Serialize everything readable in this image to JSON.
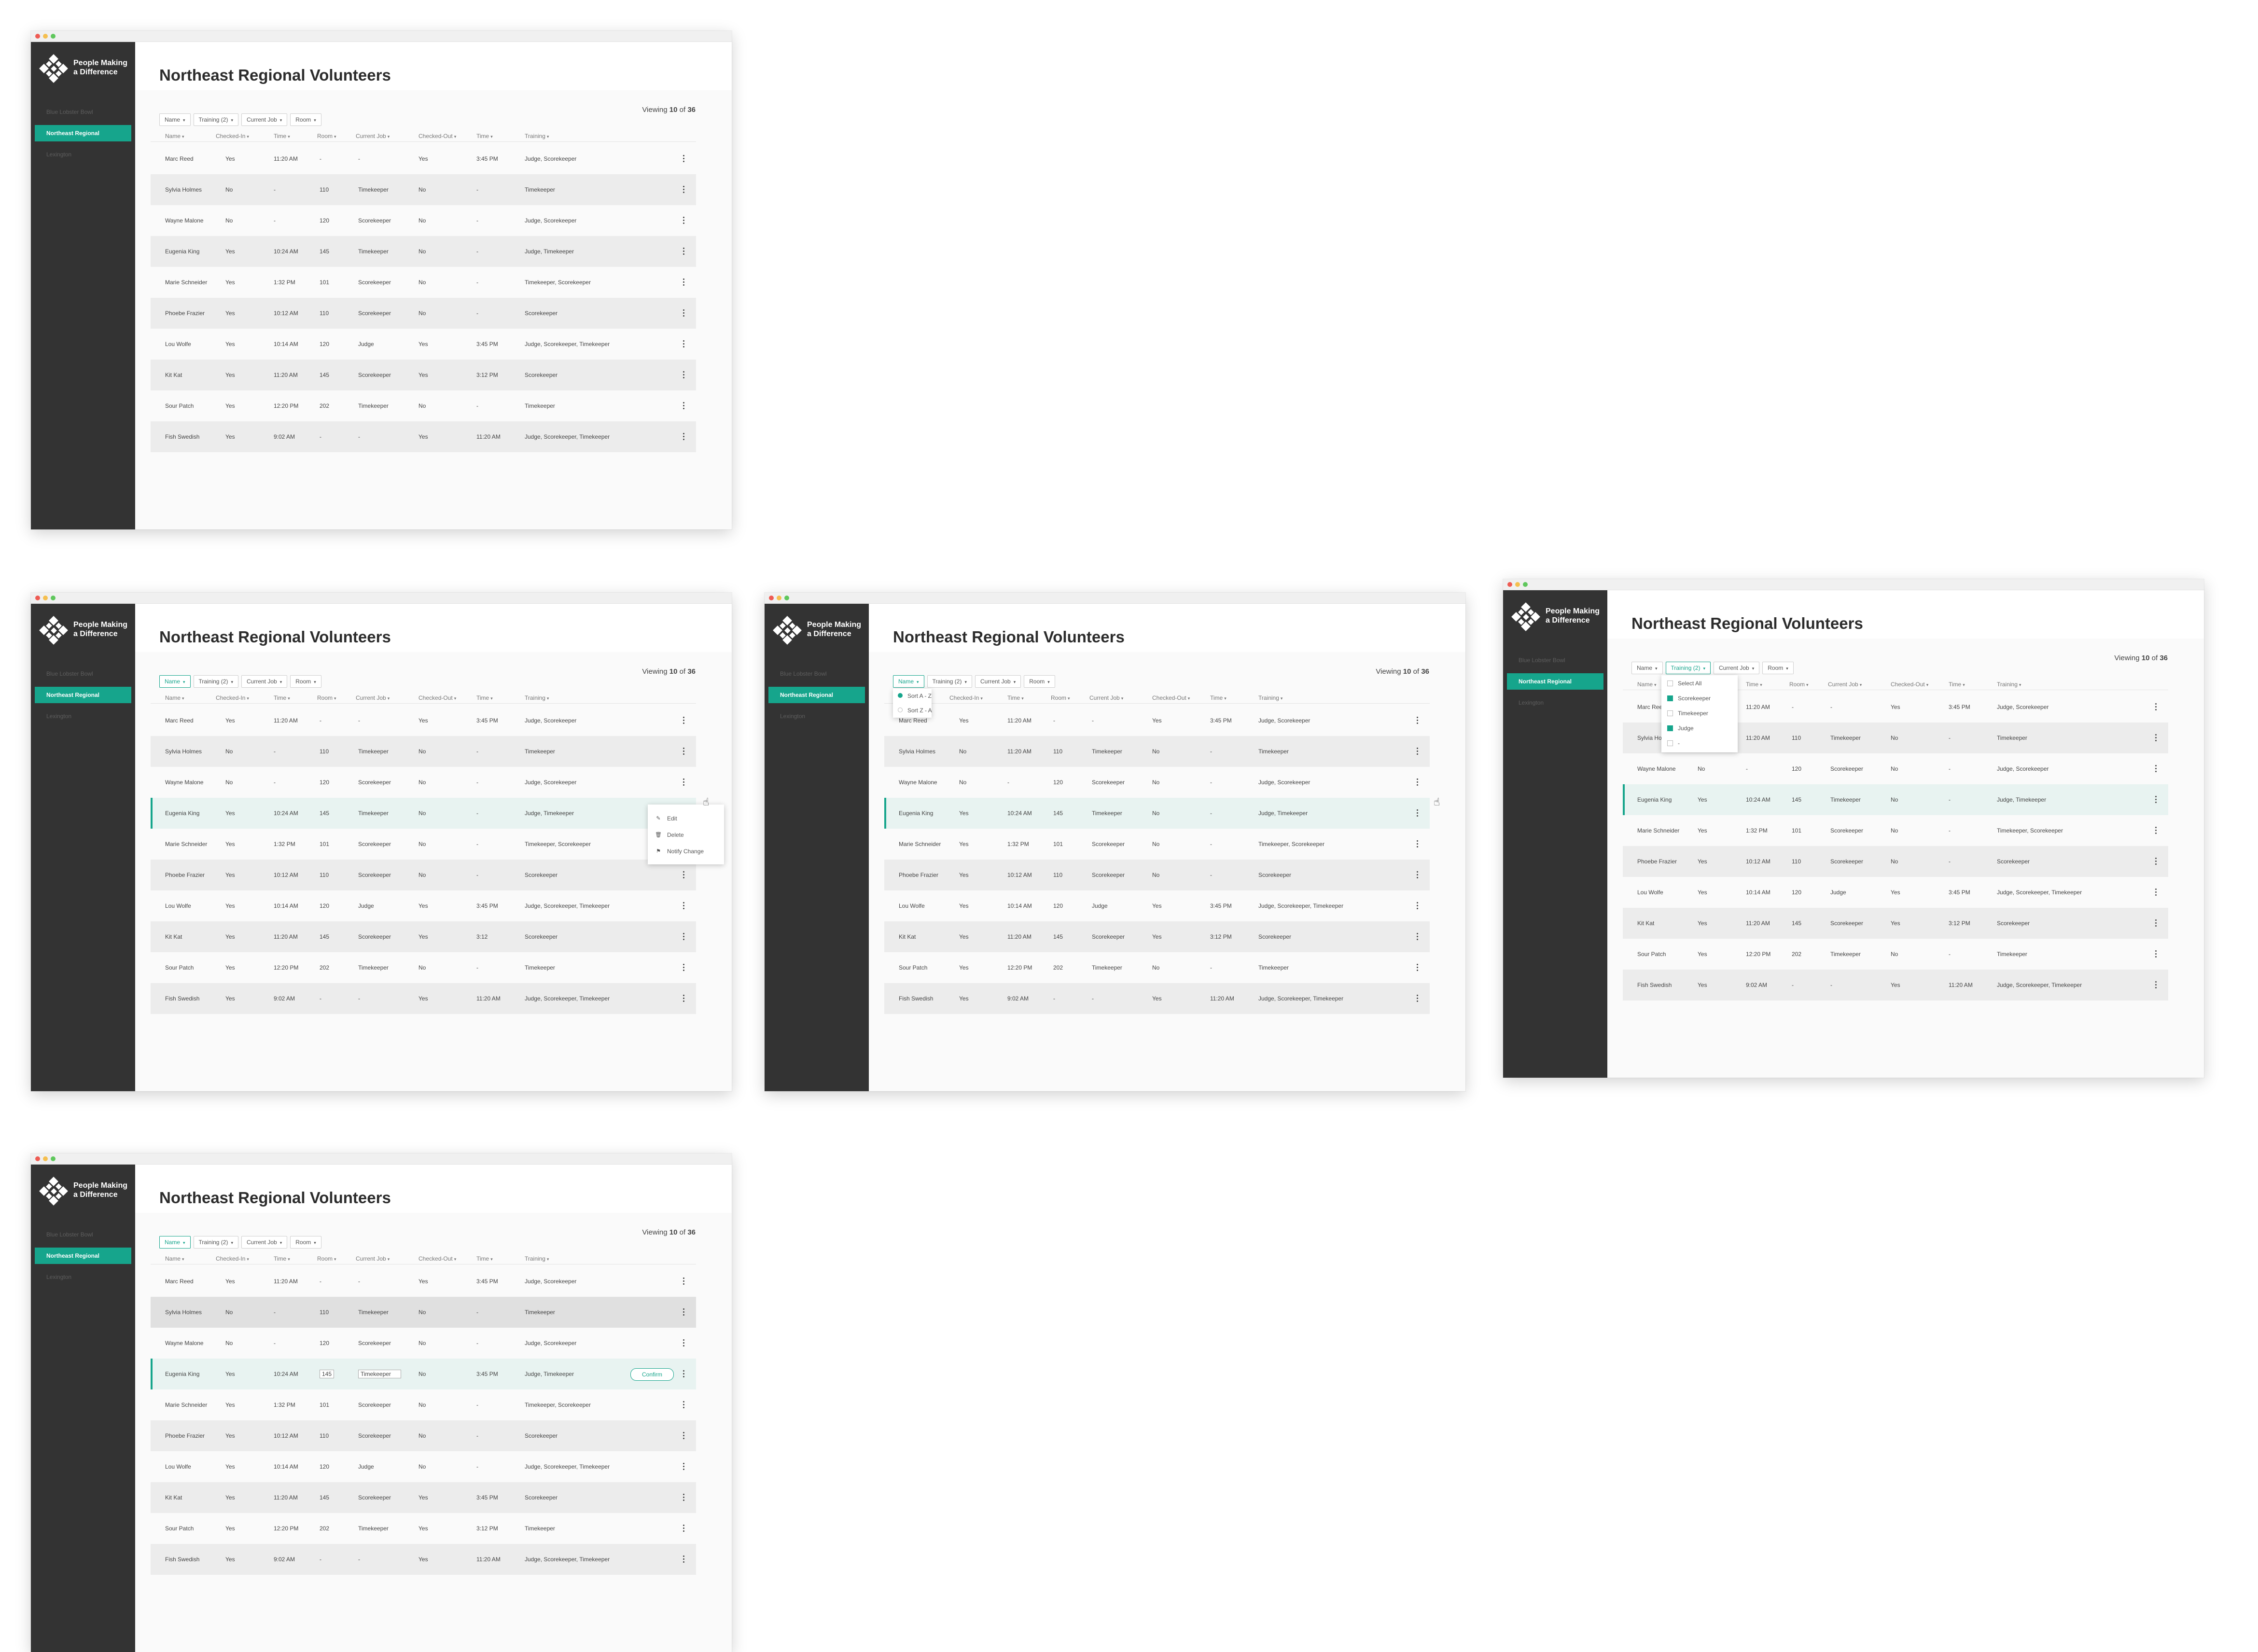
{
  "app": {
    "brand": [
      "People Making",
      "a Difference"
    ],
    "page_title": "Northeast Regional Volunteers",
    "nav": [
      "Blue Lobster Bowl",
      "Northeast Regional",
      "Lexington"
    ],
    "filters": [
      "Name",
      "Training (2)",
      "Current Job",
      "Room"
    ],
    "viewing": {
      "prefix": "Viewing",
      "shown": "10",
      "of": "of",
      "total": "36"
    },
    "columns": [
      "Name",
      "Checked-In",
      "Time",
      "Room",
      "Current Job",
      "Checked-Out",
      "Time",
      "Training"
    ],
    "accent": "#16a58c",
    "sidebar_bg": "#333333"
  },
  "screens": [
    {
      "rows": [
        [
          "Marc Reed",
          "Yes",
          "11:20 AM",
          "-",
          "-",
          "Yes",
          "3:45 PM",
          "Judge, Scorekeeper"
        ],
        [
          "Sylvia Holmes",
          "No",
          "-",
          "110",
          "Timekeeper",
          "No",
          "-",
          "Timekeeper"
        ],
        [
          "Wayne Malone",
          "No",
          "-",
          "120",
          "Scorekeeper",
          "No",
          "-",
          "Judge, Scorekeeper"
        ],
        [
          "Eugenia King",
          "Yes",
          "10:24 AM",
          "145",
          "Timekeeper",
          "No",
          "-",
          "Judge, Timekeeper"
        ],
        [
          "Marie Schneider",
          "Yes",
          "1:32 PM",
          "101",
          "Scorekeeper",
          "No",
          "-",
          "Timekeeper, Scorekeeper"
        ],
        [
          "Phoebe Frazier",
          "Yes",
          "10:12 AM",
          "110",
          "Scorekeeper",
          "No",
          "-",
          "Scorekeeper"
        ],
        [
          "Lou Wolfe",
          "Yes",
          "10:14 AM",
          "120",
          "Judge",
          "Yes",
          "3:45 PM",
          "Judge, Scorekeeper, Timekeeper"
        ],
        [
          "Kit Kat",
          "Yes",
          "11:20 AM",
          "145",
          "Scorekeeper",
          "Yes",
          "3:12 PM",
          "Scorekeeper"
        ],
        [
          "Sour Patch",
          "Yes",
          "12:20 PM",
          "202",
          "Timekeeper",
          "No",
          "-",
          "Timekeeper"
        ],
        [
          "Fish Swedish",
          "Yes",
          "9:02 AM",
          "-",
          "-",
          "Yes",
          "11:20 AM",
          "Judge, Scorekeeper, Timekeeper"
        ]
      ]
    },
    {
      "rows": [
        [
          "Marc Reed",
          "Yes",
          "11:20 AM",
          "-",
          "-",
          "Yes",
          "3:45 PM",
          "Judge, Scorekeeper"
        ],
        [
          "Sylvia Holmes",
          "No",
          "-",
          "110",
          "Timekeeper",
          "No",
          "-",
          "Timekeeper"
        ],
        [
          "Wayne Malone",
          "No",
          "-",
          "120",
          "Scorekeeper",
          "No",
          "-",
          "Judge, Scorekeeper"
        ],
        [
          "Eugenia King",
          "Yes",
          "10:24 AM",
          "145",
          "Timekeeper",
          "No",
          "-",
          "Judge, Timekeeper"
        ],
        [
          "Marie Schneider",
          "Yes",
          "1:32 PM",
          "101",
          "Scorekeeper",
          "No",
          "-",
          "Timekeeper, Scorekeeper"
        ],
        [
          "Phoebe Frazier",
          "Yes",
          "10:12 AM",
          "110",
          "Scorekeeper",
          "No",
          "-",
          "Scorekeeper"
        ],
        [
          "Lou Wolfe",
          "Yes",
          "10:14 AM",
          "120",
          "Judge",
          "Yes",
          "3:45 PM",
          "Judge, Scorekeeper, Timekeeper"
        ],
        [
          "Kit Kat",
          "Yes",
          "11:20 AM",
          "145",
          "Scorekeeper",
          "Yes",
          "3:12",
          "Scorekeeper"
        ],
        [
          "Sour Patch",
          "Yes",
          "12:20 PM",
          "202",
          "Timekeeper",
          "No",
          "-",
          "Timekeeper"
        ],
        [
          "Fish Swedish",
          "Yes",
          "9:02 AM",
          "-",
          "-",
          "Yes",
          "11:20 AM",
          "Judge, Scorekeeper, Timekeeper"
        ]
      ],
      "context_menu": [
        "Edit",
        "Delete",
        "Notify Change"
      ]
    },
    {
      "rows": [
        [
          "Marc Reed",
          "Yes",
          "11:20 AM",
          "-",
          "-",
          "Yes",
          "3:45 PM",
          "Judge, Scorekeeper"
        ],
        [
          "Sylvia Holmes",
          "No",
          "11:20 AM",
          "110",
          "Timekeeper",
          "No",
          "-",
          "Timekeeper"
        ],
        [
          "Wayne Malone",
          "No",
          "-",
          "120",
          "Scorekeeper",
          "No",
          "-",
          "Judge, Scorekeeper"
        ],
        [
          "Eugenia King",
          "Yes",
          "10:24 AM",
          "145",
          "Timekeeper",
          "No",
          "-",
          "Judge, Timekeeper"
        ],
        [
          "Marie Schneider",
          "Yes",
          "1:32 PM",
          "101",
          "Scorekeeper",
          "No",
          "-",
          "Timekeeper, Scorekeeper"
        ],
        [
          "Phoebe Frazier",
          "Yes",
          "10:12 AM",
          "110",
          "Scorekeeper",
          "No",
          "-",
          "Scorekeeper"
        ],
        [
          "Lou Wolfe",
          "Yes",
          "10:14 AM",
          "120",
          "Judge",
          "Yes",
          "3:45 PM",
          "Judge, Scorekeeper, Timekeeper"
        ],
        [
          "Kit Kat",
          "Yes",
          "11:20 AM",
          "145",
          "Scorekeeper",
          "Yes",
          "3:12 PM",
          "Scorekeeper"
        ],
        [
          "Sour Patch",
          "Yes",
          "12:20 PM",
          "202",
          "Timekeeper",
          "No",
          "-",
          "Timekeeper"
        ],
        [
          "Fish Swedish",
          "Yes",
          "9:02 AM",
          "-",
          "-",
          "Yes",
          "11:20 AM",
          "Judge, Scorekeeper, Timekeeper"
        ]
      ],
      "sort_menu": [
        "Sort A - Z",
        "Sort Z - A"
      ]
    },
    {
      "rows": [
        [
          "Marc Reed",
          "Yes",
          "11:20 AM",
          "-",
          "-",
          "Yes",
          "3:45 PM",
          "Judge, Scorekeeper"
        ],
        [
          "Sylvia Holmes",
          "No",
          "11:20 AM",
          "110",
          "Timekeeper",
          "No",
          "-",
          "Timekeeper"
        ],
        [
          "Wayne Malone",
          "No",
          "-",
          "120",
          "Scorekeeper",
          "No",
          "-",
          "Judge, Scorekeeper"
        ],
        [
          "Eugenia King",
          "Yes",
          "10:24 AM",
          "145",
          "Timekeeper",
          "No",
          "-",
          "Judge, Timekeeper"
        ],
        [
          "Marie Schneider",
          "Yes",
          "1:32 PM",
          "101",
          "Scorekeeper",
          "No",
          "-",
          "Timekeeper, Scorekeeper"
        ],
        [
          "Phoebe Frazier",
          "Yes",
          "10:12 AM",
          "110",
          "Scorekeeper",
          "No",
          "-",
          "Scorekeeper"
        ],
        [
          "Lou Wolfe",
          "Yes",
          "10:14 AM",
          "120",
          "Judge",
          "Yes",
          "3:45 PM",
          "Judge, Scorekeeper, Timekeeper"
        ],
        [
          "Kit Kat",
          "Yes",
          "11:20 AM",
          "145",
          "Scorekeeper",
          "Yes",
          "3:12 PM",
          "Scorekeeper"
        ],
        [
          "Sour Patch",
          "Yes",
          "12:20 PM",
          "202",
          "Timekeeper",
          "No",
          "-",
          "Timekeeper"
        ],
        [
          "Fish Swedish",
          "Yes",
          "9:02 AM",
          "-",
          "-",
          "Yes",
          "11:20 AM",
          "Judge, Scorekeeper, Timekeeper"
        ]
      ],
      "training_menu": [
        {
          "label": "Select All",
          "checked": false
        },
        {
          "label": "Scorekeeper",
          "checked": true
        },
        {
          "label": "Timekeeper",
          "checked": false
        },
        {
          "label": "Judge",
          "checked": true
        },
        {
          "label": "-",
          "checked": false
        }
      ]
    },
    {
      "rows": [
        [
          "Marc Reed",
          "Yes",
          "11:20 AM",
          "-",
          "-",
          "Yes",
          "3:45 PM",
          "Judge, Scorekeeper"
        ],
        [
          "Sylvia Holmes",
          "No",
          "-",
          "110",
          "Timekeeper",
          "No",
          "-",
          "Timekeeper"
        ],
        [
          "Wayne Malone",
          "No",
          "-",
          "120",
          "Scorekeeper",
          "No",
          "-",
          "Judge, Scorekeeper"
        ],
        [
          "Eugenia King",
          "Yes",
          "10:24 AM",
          "145",
          "Timekeeper",
          "No",
          "3:45 PM",
          "Judge, Timekeeper"
        ],
        [
          "Marie Schneider",
          "Yes",
          "1:32 PM",
          "101",
          "Scorekeeper",
          "No",
          "-",
          "Timekeeper, Scorekeeper"
        ],
        [
          "Phoebe Frazier",
          "Yes",
          "10:12 AM",
          "110",
          "Scorekeeper",
          "No",
          "-",
          "Scorekeeper"
        ],
        [
          "Lou Wolfe",
          "Yes",
          "10:14 AM",
          "120",
          "Judge",
          "No",
          "-",
          "Judge, Scorekeeper, Timekeeper"
        ],
        [
          "Kit Kat",
          "Yes",
          "11:20 AM",
          "145",
          "Scorekeeper",
          "Yes",
          "3:45 PM",
          "Scorekeeper"
        ],
        [
          "Sour Patch",
          "Yes",
          "12:20 PM",
          "202",
          "Timekeeper",
          "Yes",
          "3:12 PM",
          "Timekeeper"
        ],
        [
          "Fish Swedish",
          "Yes",
          "9:02 AM",
          "-",
          "-",
          "Yes",
          "11:20 AM",
          "Judge, Scorekeeper, Timekeeper"
        ]
      ],
      "confirm_label": "Confirm"
    }
  ]
}
